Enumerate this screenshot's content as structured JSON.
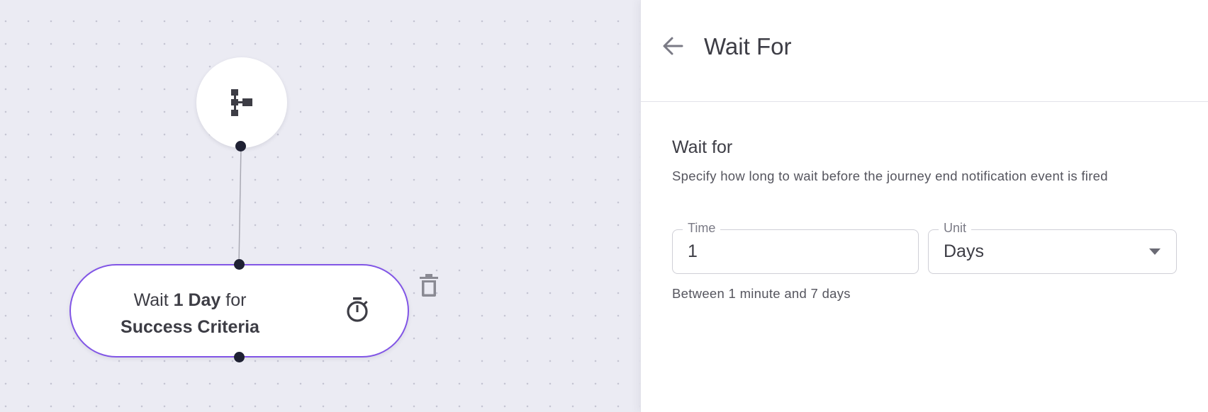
{
  "canvas": {
    "wait_node": {
      "prefix": "Wait ",
      "duration": "1 Day",
      "middle": " for",
      "target": "Success Criteria"
    },
    "icons": {
      "start": "journey-tree-icon",
      "timer": "stopwatch-icon",
      "delete": "trash-icon"
    },
    "colors": {
      "node_border": "#8155e6",
      "port": "#1f2133",
      "background": "#ebebf3"
    }
  },
  "panel": {
    "title": "Wait For",
    "section_title": "Wait for",
    "description": "Specify how long to wait before the journey end notification event is fired",
    "time_field": {
      "label": "Time",
      "value": "1"
    },
    "unit_field": {
      "label": "Unit",
      "value": "Days"
    },
    "helper_text": "Between 1 minute and 7 days"
  }
}
